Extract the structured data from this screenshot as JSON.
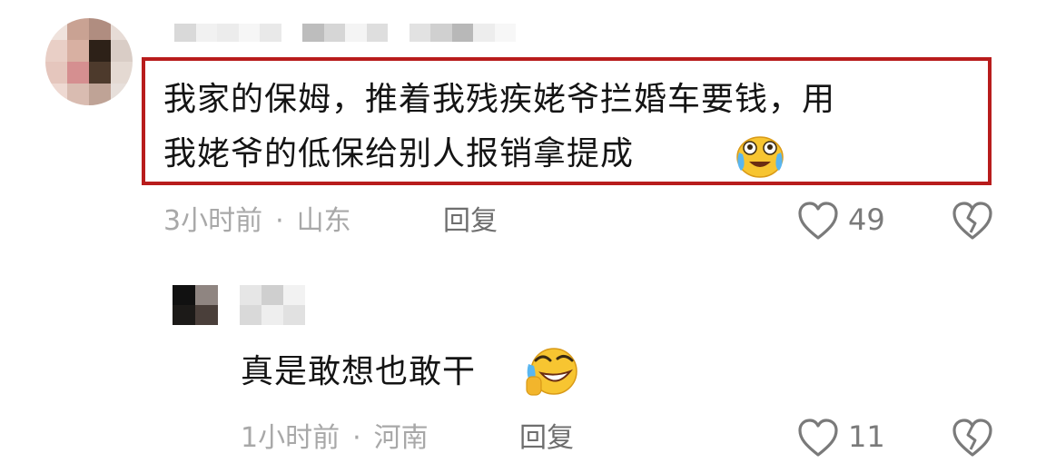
{
  "comments": [
    {
      "text_line1": "我家的保姆，推着我残疾姥爷拦婚车要钱，用",
      "text_line2": "我姥爷的低保给别人报销拿提成",
      "emoji": "crying-laughing-face-icon",
      "time": "3小时前",
      "separator": "·",
      "location": "山东",
      "reply_label": "回复",
      "likes": "49"
    },
    {
      "text": "真是敢想也敢干",
      "emoji": "rolling-laughing-face-icon",
      "time": "1小时前",
      "separator": "·",
      "location": "河南",
      "reply_label": "回复",
      "likes": "11"
    }
  ],
  "colors": {
    "highlight_border": "#b81c1c",
    "text": "#141414",
    "meta": "#a8a8a8",
    "icon": "#7a7a7a"
  }
}
